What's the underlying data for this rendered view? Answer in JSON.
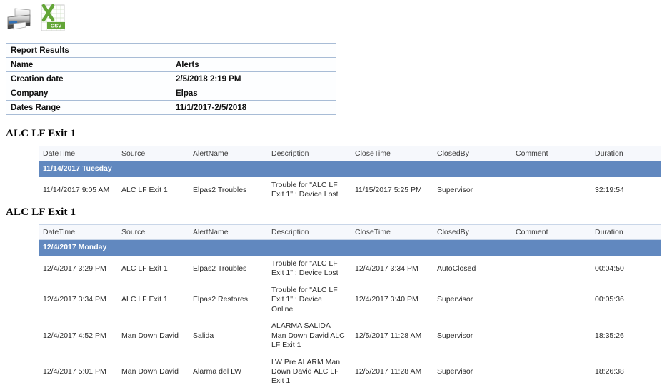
{
  "toolbar": {
    "print_label": "Print",
    "export_label": "Export to CSV",
    "csv_badge": "CSV",
    "excel_letter": "X"
  },
  "report_results": {
    "title": "Report Results",
    "rows": [
      {
        "label": "Name",
        "value": "Alerts"
      },
      {
        "label": "Creation date",
        "value": "2/5/2018 2:19 PM"
      },
      {
        "label": "Company",
        "value": "Elpas"
      },
      {
        "label": "Dates Range",
        "value": "11/1/2017-2/5/2018"
      }
    ]
  },
  "columns": [
    "DateTime",
    "Source",
    "AlertName",
    "Description",
    "CloseTime",
    "ClosedBy",
    "Comment",
    "Duration"
  ],
  "sections": [
    {
      "title": "ALC LF Exit 1",
      "day_group": "11/14/2017 Tuesday",
      "rows": [
        {
          "datetime": "11/14/2017 9:05 AM",
          "source": "ALC LF Exit 1",
          "alertname": "Elpas2 Troubles",
          "description": "Trouble for \"ALC LF Exit 1\" : Device Lost",
          "closetime": "11/15/2017 5:25 PM",
          "closedby": "Supervisor",
          "comment": "",
          "duration": "32:19:54"
        }
      ]
    },
    {
      "title": "ALC LF Exit 1",
      "day_group": "12/4/2017 Monday",
      "rows": [
        {
          "datetime": "12/4/2017 3:29 PM",
          "source": "ALC LF Exit 1",
          "alertname": "Elpas2 Troubles",
          "description": "Trouble for \"ALC LF Exit 1\" : Device Lost",
          "closetime": "12/4/2017 3:34 PM",
          "closedby": "AutoClosed",
          "comment": "",
          "duration": "00:04:50"
        },
        {
          "datetime": "12/4/2017 3:34 PM",
          "source": "ALC LF Exit 1",
          "alertname": "Elpas2 Restores",
          "description": "Trouble for \"ALC LF Exit 1\" : Device Online",
          "closetime": "12/4/2017 3:40 PM",
          "closedby": "Supervisor",
          "comment": "",
          "duration": "00:05:36"
        },
        {
          "datetime": "12/4/2017 4:52 PM",
          "source": "Man Down David",
          "alertname": "Salida",
          "description": "ALARMA SALIDA Man Down David ALC LF Exit 1",
          "closetime": "12/5/2017 11:28 AM",
          "closedby": "Supervisor",
          "comment": "",
          "duration": "18:35:26"
        },
        {
          "datetime": "12/4/2017 5:01 PM",
          "source": "Man Down David",
          "alertname": "Alarma del LW",
          "description": "LW Pre ALARM Man Down David ALC LF Exit 1",
          "closetime": "12/5/2017 11:28 AM",
          "closedby": "Supervisor",
          "comment": "",
          "duration": "18:26:38"
        }
      ]
    }
  ],
  "colors": {
    "day_group_blue": "#6188bf",
    "header_fill": "#f6f8fc",
    "grid_border": "#a8bcd6",
    "csv_green": "#63a537"
  }
}
